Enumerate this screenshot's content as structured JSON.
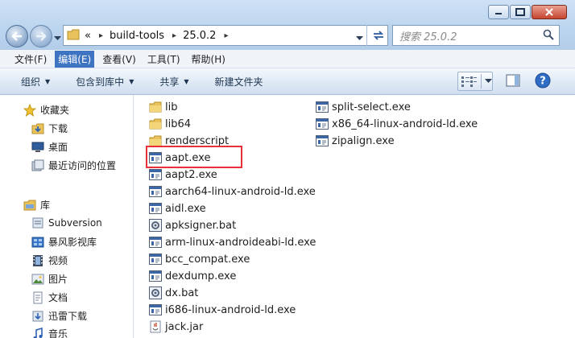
{
  "address": {
    "prefix": "«",
    "crumbs": [
      "build-tools",
      "25.0.2"
    ]
  },
  "search": {
    "placeholder": "搜索 25.0.2"
  },
  "menu": [
    "文件(F)",
    "编辑(E)",
    "查看(V)",
    "工具(T)",
    "帮助(H)"
  ],
  "commands": [
    "组织",
    "包含到库中",
    "共享",
    "新建文件夹"
  ],
  "nav": {
    "favorites": "收藏夹",
    "favorites_items": [
      "下载",
      "桌面",
      "最近访问的位置"
    ],
    "libraries": "库",
    "libraries_items": [
      "Subversion",
      "暴风影视库",
      "视频",
      "图片",
      "文档",
      "迅雷下载",
      "音乐"
    ]
  },
  "files_col1": [
    {
      "name": "lib",
      "type": "folder"
    },
    {
      "name": "lib64",
      "type": "folder"
    },
    {
      "name": "renderscript",
      "type": "folder"
    },
    {
      "name": "aapt.exe",
      "type": "exe"
    },
    {
      "name": "aapt2.exe",
      "type": "exe"
    },
    {
      "name": "aarch64-linux-android-ld.exe",
      "type": "exe"
    },
    {
      "name": "aidl.exe",
      "type": "exe"
    },
    {
      "name": "apksigner.bat",
      "type": "bat"
    },
    {
      "name": "arm-linux-androideabi-ld.exe",
      "type": "exe"
    },
    {
      "name": "bcc_compat.exe",
      "type": "exe"
    },
    {
      "name": "dexdump.exe",
      "type": "exe"
    },
    {
      "name": "dx.bat",
      "type": "bat"
    },
    {
      "name": "i686-linux-android-ld.exe",
      "type": "exe"
    },
    {
      "name": "jack.jar",
      "type": "jar"
    }
  ],
  "files_col2": [
    {
      "name": "split-select.exe",
      "type": "exe"
    },
    {
      "name": "x86_64-linux-android-ld.exe",
      "type": "exe"
    },
    {
      "name": "zipalign.exe",
      "type": "exe"
    }
  ],
  "colors": {
    "highlight": "#e8303a",
    "menu_active": "#3e74c2"
  }
}
